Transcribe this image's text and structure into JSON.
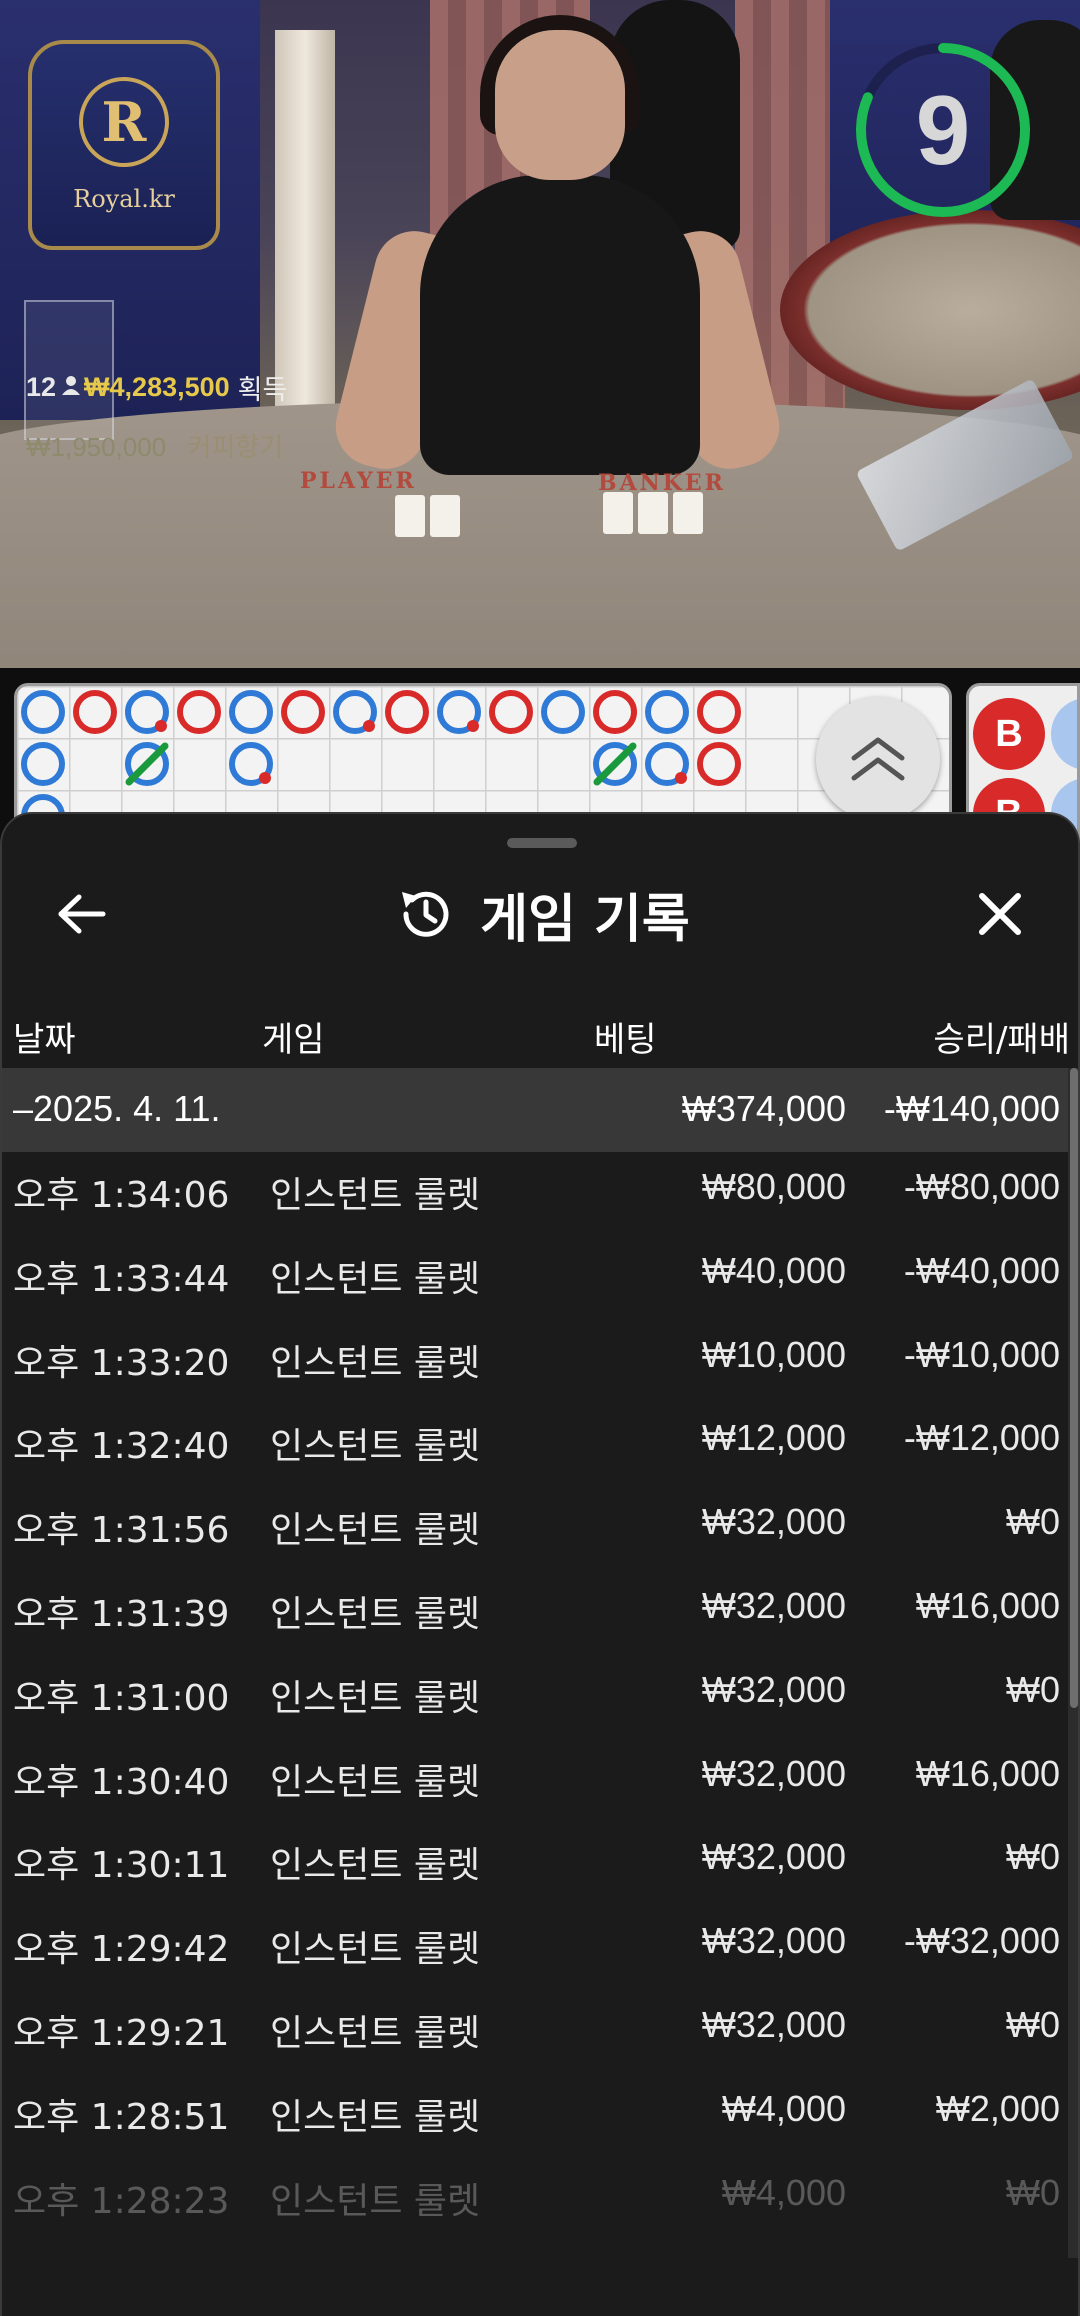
{
  "video": {
    "logo_letter": "R",
    "logo_text": "Royal.kr",
    "felt_player": "PLAYER",
    "felt_banker": "BANKER",
    "timer": "9",
    "timer_color": "#1db954",
    "bet_info": {
      "players": "12",
      "amount": "₩4,283,500",
      "won_label": "획득",
      "top_amount": "₩1,950,000",
      "top_user": "커피향기"
    }
  },
  "roadboard": {
    "beads_row1": [
      "blue",
      "red",
      "blue-dot",
      "red",
      "blue",
      "red",
      "blue-dot",
      "red",
      "blue-dot",
      "red",
      "blue",
      "red",
      "blue",
      "red"
    ],
    "beads_row2": [
      "blue",
      "",
      "green-slash",
      "",
      "blue-dot",
      "",
      "",
      "",
      "",
      "",
      "",
      "green-slash",
      "blue-dot",
      "red"
    ],
    "bigroad_label": "B",
    "colors": {
      "blue": "#2f7ad6",
      "red": "#d92a2a",
      "green": "#1a9a3c"
    }
  },
  "sheet": {
    "title": "게임 기록",
    "icons": {
      "back": "arrow-left-icon",
      "history": "history-icon",
      "close": "close-icon"
    },
    "headers": {
      "date": "날짜",
      "game": "게임",
      "bet": "베팅",
      "win_loss": "승리/패배"
    },
    "summary": {
      "date": "–2025. 4. 11.",
      "bet": "₩374,000",
      "win_loss": "-₩140,000"
    },
    "rows": [
      {
        "time": "오후 1:34:06",
        "game": "인스턴트 룰렛",
        "bet": "₩80,000",
        "win_loss": "-₩80,000"
      },
      {
        "time": "오후 1:33:44",
        "game": "인스턴트 룰렛",
        "bet": "₩40,000",
        "win_loss": "-₩40,000"
      },
      {
        "time": "오후 1:33:20",
        "game": "인스턴트 룰렛",
        "bet": "₩10,000",
        "win_loss": "-₩10,000"
      },
      {
        "time": "오후 1:32:40",
        "game": "인스턴트 룰렛",
        "bet": "₩12,000",
        "win_loss": "-₩12,000"
      },
      {
        "time": "오후 1:31:56",
        "game": "인스턴트 룰렛",
        "bet": "₩32,000",
        "win_loss": "₩0"
      },
      {
        "time": "오후 1:31:39",
        "game": "인스턴트 룰렛",
        "bet": "₩32,000",
        "win_loss": "₩16,000"
      },
      {
        "time": "오후 1:31:00",
        "game": "인스턴트 룰렛",
        "bet": "₩32,000",
        "win_loss": "₩0"
      },
      {
        "time": "오후 1:30:40",
        "game": "인스턴트 룰렛",
        "bet": "₩32,000",
        "win_loss": "₩16,000"
      },
      {
        "time": "오후 1:30:11",
        "game": "인스턴트 룰렛",
        "bet": "₩32,000",
        "win_loss": "₩0"
      },
      {
        "time": "오후 1:29:42",
        "game": "인스턴트 룰렛",
        "bet": "₩32,000",
        "win_loss": "-₩32,000"
      },
      {
        "time": "오후 1:29:21",
        "game": "인스턴트 룰렛",
        "bet": "₩32,000",
        "win_loss": "₩0"
      },
      {
        "time": "오후 1:28:51",
        "game": "인스턴트 룰렛",
        "bet": "₩4,000",
        "win_loss": "₩2,000"
      },
      {
        "time": "오후 1:28:23",
        "game": "인스턴트 룰렛",
        "bet": "₩4,000",
        "win_loss": "₩0"
      }
    ]
  }
}
